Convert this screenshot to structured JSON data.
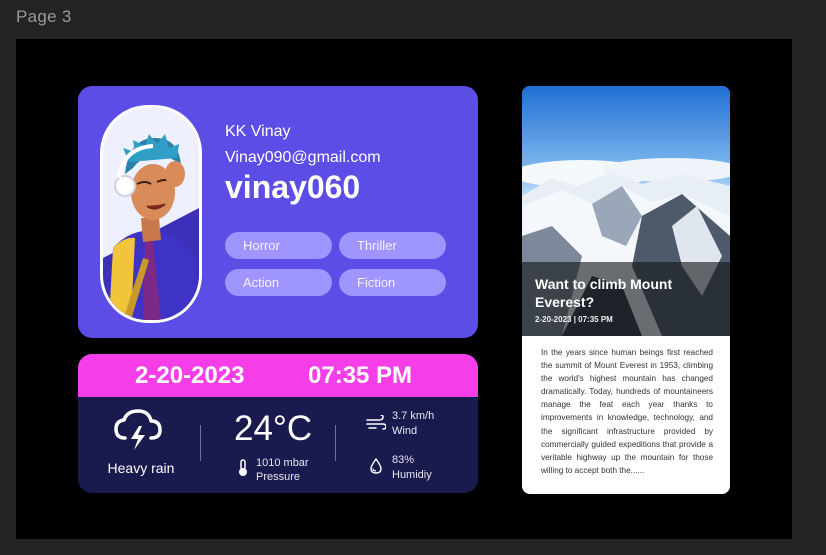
{
  "page": {
    "label": "Page 3"
  },
  "profile": {
    "name": "KK Vinay",
    "email": "Vinay090@gmail.com",
    "handle": "vinay060",
    "tags": [
      "Horror",
      "Thriller",
      "Action",
      "Fiction"
    ]
  },
  "weather": {
    "date": "2-20-2023",
    "time": "07:35 PM",
    "condition": "Heavy rain",
    "temperature": "24°C",
    "pressure_value": "1010 mbar",
    "pressure_label": "Pressure",
    "wind_value": "3.7 km/h",
    "wind_label": "Wind",
    "humidity_value": "83%",
    "humidity_label": "Humidiy",
    "icons": [
      "thunder-cloud-icon",
      "thermometer-icon",
      "wind-icon",
      "humidity-drop-icon"
    ]
  },
  "article": {
    "title": "Want to climb Mount Everest?",
    "meta": "2-20-2023 | 07:35 PM",
    "body": "In the years since human beings first reached the summit of Mount Everest in 1953, climbing the world's highest mountain has changed dramatically. Today, hundreds of mountaineers manage the feat each year thanks to improvements in knowledge, technology, and the significant infrastructure provided by commercially guided expeditions that provide a veritable highway up the mountain for those willing to accept both the......"
  },
  "colors": {
    "profile_bg": "#5b4de6",
    "tag_bg": "#9e95ff",
    "weather_header": "#f63ee8",
    "weather_body": "#191b4e"
  }
}
